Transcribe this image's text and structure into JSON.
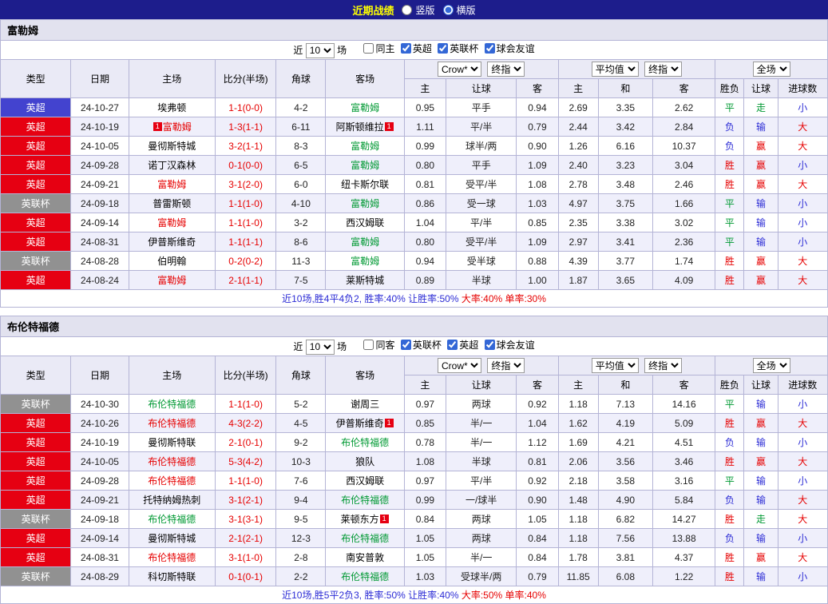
{
  "topbar": {
    "title": "近期战绩",
    "radios": [
      {
        "label": "竖版",
        "selected": false
      },
      {
        "label": "横版",
        "selected": true
      }
    ]
  },
  "filter_text": {
    "prefix": "近",
    "count": "10",
    "suffix": "场"
  },
  "table_header": {
    "main_cols": [
      "类型",
      "日期",
      "主场",
      "比分(半场)",
      "角球",
      "客场"
    ],
    "odds1": {
      "book": "Crow*",
      "stage": "终指",
      "cols": [
        "主",
        "让球",
        "客"
      ]
    },
    "odds2": {
      "book": "平均值",
      "stage": "终指",
      "cols": [
        "主",
        "和",
        "客"
      ]
    },
    "result": {
      "scope": "全场",
      "cols": [
        "胜负",
        "让球",
        "进球数"
      ]
    }
  },
  "team_colors": {
    "black": "#000000",
    "red": "#e60000",
    "green": "#009933"
  },
  "type_colors": {
    "red": "#e60012",
    "gray": "#919191",
    "blue": "#4343cf"
  },
  "result_colors": {
    "胜": "#e60000",
    "平": "#009933",
    "负": "#2b2bd5",
    "赢": "#e60000",
    "走": "#009933",
    "输": "#2b2bd5",
    "大": "#e60000",
    "小": "#2b2bd5"
  },
  "sections": [
    {
      "team": "富勒姆",
      "checkboxes": [
        {
          "label": "同主",
          "checked": false
        },
        {
          "label": "英超",
          "checked": true
        },
        {
          "label": "英联杯",
          "checked": true
        },
        {
          "label": "球会友谊",
          "checked": true
        }
      ],
      "rows": [
        {
          "type": "英超",
          "type_color": "blue",
          "date": "24-10-27",
          "home": {
            "name": "埃弗顿",
            "color": "black"
          },
          "score": "1-1(0-0)",
          "corner": "4-2",
          "away": {
            "name": "富勒姆",
            "color": "green"
          },
          "odds": [
            "0.95",
            "平手",
            "0.94",
            "2.69",
            "3.35",
            "2.62"
          ],
          "results": [
            "平",
            "走",
            "小"
          ]
        },
        {
          "type": "英超",
          "type_color": "red",
          "date": "24-10-19",
          "home": {
            "name": "富勒姆",
            "color": "red",
            "badge": "1",
            "badge_pos": "before"
          },
          "score": "1-3(1-1)",
          "corner": "6-11",
          "away": {
            "name": "阿斯顿维拉",
            "color": "black",
            "badge": "1",
            "badge_pos": "after"
          },
          "odds": [
            "1.11",
            "平/半",
            "0.79",
            "2.44",
            "3.42",
            "2.84"
          ],
          "results": [
            "负",
            "输",
            "大"
          ]
        },
        {
          "type": "英超",
          "type_color": "red",
          "date": "24-10-05",
          "home": {
            "name": "曼彻斯特城",
            "color": "black"
          },
          "score": "3-2(1-1)",
          "corner": "8-3",
          "away": {
            "name": "富勒姆",
            "color": "green"
          },
          "odds": [
            "0.99",
            "球半/两",
            "0.90",
            "1.26",
            "6.16",
            "10.37"
          ],
          "results": [
            "负",
            "赢",
            "大"
          ]
        },
        {
          "type": "英超",
          "type_color": "red",
          "date": "24-09-28",
          "home": {
            "name": "诺丁汉森林",
            "color": "black"
          },
          "score": "0-1(0-0)",
          "corner": "6-5",
          "away": {
            "name": "富勒姆",
            "color": "green"
          },
          "odds": [
            "0.80",
            "平手",
            "1.09",
            "2.40",
            "3.23",
            "3.04"
          ],
          "results": [
            "胜",
            "赢",
            "小"
          ]
        },
        {
          "type": "英超",
          "type_color": "red",
          "date": "24-09-21",
          "home": {
            "name": "富勒姆",
            "color": "red"
          },
          "score": "3-1(2-0)",
          "corner": "6-0",
          "away": {
            "name": "纽卡斯尔联",
            "color": "black"
          },
          "odds": [
            "0.81",
            "受平/半",
            "1.08",
            "2.78",
            "3.48",
            "2.46"
          ],
          "results": [
            "胜",
            "赢",
            "大"
          ]
        },
        {
          "type": "英联杯",
          "type_color": "gray",
          "date": "24-09-18",
          "home": {
            "name": "普雷斯顿",
            "color": "black"
          },
          "score": "1-1(1-0)",
          "corner": "4-10",
          "away": {
            "name": "富勒姆",
            "color": "green"
          },
          "odds": [
            "0.86",
            "受一球",
            "1.03",
            "4.97",
            "3.75",
            "1.66"
          ],
          "results": [
            "平",
            "输",
            "小"
          ]
        },
        {
          "type": "英超",
          "type_color": "red",
          "date": "24-09-14",
          "home": {
            "name": "富勒姆",
            "color": "red"
          },
          "score": "1-1(1-0)",
          "corner": "3-2",
          "away": {
            "name": "西汉姆联",
            "color": "black"
          },
          "odds": [
            "1.04",
            "平/半",
            "0.85",
            "2.35",
            "3.38",
            "3.02"
          ],
          "results": [
            "平",
            "输",
            "小"
          ]
        },
        {
          "type": "英超",
          "type_color": "red",
          "date": "24-08-31",
          "home": {
            "name": "伊普斯维奇",
            "color": "black"
          },
          "score": "1-1(1-1)",
          "corner": "8-6",
          "away": {
            "name": "富勒姆",
            "color": "green"
          },
          "odds": [
            "0.80",
            "受平/半",
            "1.09",
            "2.97",
            "3.41",
            "2.36"
          ],
          "results": [
            "平",
            "输",
            "小"
          ]
        },
        {
          "type": "英联杯",
          "type_color": "gray",
          "date": "24-08-28",
          "home": {
            "name": "伯明翰",
            "color": "black"
          },
          "score": "0-2(0-2)",
          "corner": "11-3",
          "away": {
            "name": "富勒姆",
            "color": "green"
          },
          "odds": [
            "0.94",
            "受半球",
            "0.88",
            "4.39",
            "3.77",
            "1.74"
          ],
          "results": [
            "胜",
            "赢",
            "大"
          ]
        },
        {
          "type": "英超",
          "type_color": "red",
          "date": "24-08-24",
          "home": {
            "name": "富勒姆",
            "color": "red"
          },
          "score": "2-1(1-1)",
          "corner": "7-5",
          "away": {
            "name": "莱斯特城",
            "color": "black"
          },
          "odds": [
            "0.89",
            "半球",
            "1.00",
            "1.87",
            "3.65",
            "4.09"
          ],
          "results": [
            "胜",
            "赢",
            "大"
          ]
        }
      ],
      "summary": [
        {
          "text": "近10场,胜4平4负2, ",
          "color": "#2b2bd5"
        },
        {
          "text": "胜率:40% ",
          "color": "#2b2bd5"
        },
        {
          "text": "让胜率:50% ",
          "color": "#2b2bd5"
        },
        {
          "text": "大率:40% ",
          "color": "#e60000"
        },
        {
          "text": "单率:30%",
          "color": "#e60000"
        }
      ]
    },
    {
      "team": "布伦特福德",
      "checkboxes": [
        {
          "label": "同客",
          "checked": false
        },
        {
          "label": "英联杯",
          "checked": true
        },
        {
          "label": "英超",
          "checked": true
        },
        {
          "label": "球会友谊",
          "checked": true
        }
      ],
      "rows": [
        {
          "type": "英联杯",
          "type_color": "gray",
          "date": "24-10-30",
          "home": {
            "name": "布伦特福德",
            "color": "green"
          },
          "score": "1-1(1-0)",
          "corner": "5-2",
          "away": {
            "name": "谢周三",
            "color": "black"
          },
          "odds": [
            "0.97",
            "两球",
            "0.92",
            "1.18",
            "7.13",
            "14.16"
          ],
          "results": [
            "平",
            "输",
            "小"
          ]
        },
        {
          "type": "英超",
          "type_color": "red",
          "date": "24-10-26",
          "home": {
            "name": "布伦特福德",
            "color": "red"
          },
          "score": "4-3(2-2)",
          "corner": "4-5",
          "away": {
            "name": "伊普斯维奇",
            "color": "black",
            "badge": "1",
            "badge_pos": "after"
          },
          "odds": [
            "0.85",
            "半/一",
            "1.04",
            "1.62",
            "4.19",
            "5.09"
          ],
          "results": [
            "胜",
            "赢",
            "大"
          ]
        },
        {
          "type": "英超",
          "type_color": "red",
          "date": "24-10-19",
          "home": {
            "name": "曼彻斯特联",
            "color": "black"
          },
          "score": "2-1(0-1)",
          "corner": "9-2",
          "away": {
            "name": "布伦特福德",
            "color": "green"
          },
          "odds": [
            "0.78",
            "半/一",
            "1.12",
            "1.69",
            "4.21",
            "4.51"
          ],
          "results": [
            "负",
            "输",
            "小"
          ]
        },
        {
          "type": "英超",
          "type_color": "red",
          "date": "24-10-05",
          "home": {
            "name": "布伦特福德",
            "color": "red"
          },
          "score": "5-3(4-2)",
          "corner": "10-3",
          "away": {
            "name": "狼队",
            "color": "black"
          },
          "odds": [
            "1.08",
            "半球",
            "0.81",
            "2.06",
            "3.56",
            "3.46"
          ],
          "results": [
            "胜",
            "赢",
            "大"
          ]
        },
        {
          "type": "英超",
          "type_color": "red",
          "date": "24-09-28",
          "home": {
            "name": "布伦特福德",
            "color": "red"
          },
          "score": "1-1(1-0)",
          "corner": "7-6",
          "away": {
            "name": "西汉姆联",
            "color": "black"
          },
          "odds": [
            "0.97",
            "平/半",
            "0.92",
            "2.18",
            "3.58",
            "3.16"
          ],
          "results": [
            "平",
            "输",
            "小"
          ]
        },
        {
          "type": "英超",
          "type_color": "red",
          "date": "24-09-21",
          "home": {
            "name": "托特纳姆热刺",
            "color": "black"
          },
          "score": "3-1(2-1)",
          "corner": "9-4",
          "away": {
            "name": "布伦特福德",
            "color": "green"
          },
          "odds": [
            "0.99",
            "一/球半",
            "0.90",
            "1.48",
            "4.90",
            "5.84"
          ],
          "results": [
            "负",
            "输",
            "大"
          ]
        },
        {
          "type": "英联杯",
          "type_color": "gray",
          "date": "24-09-18",
          "home": {
            "name": "布伦特福德",
            "color": "green"
          },
          "score": "3-1(3-1)",
          "corner": "9-5",
          "away": {
            "name": "莱顿东方",
            "color": "black",
            "badge": "1",
            "badge_pos": "after"
          },
          "odds": [
            "0.84",
            "两球",
            "1.05",
            "1.18",
            "6.82",
            "14.27"
          ],
          "results": [
            "胜",
            "走",
            "大"
          ]
        },
        {
          "type": "英超",
          "type_color": "red",
          "date": "24-09-14",
          "home": {
            "name": "曼彻斯特城",
            "color": "black"
          },
          "score": "2-1(2-1)",
          "corner": "12-3",
          "away": {
            "name": "布伦特福德",
            "color": "green"
          },
          "odds": [
            "1.05",
            "两球",
            "0.84",
            "1.18",
            "7.56",
            "13.88"
          ],
          "results": [
            "负",
            "输",
            "小"
          ]
        },
        {
          "type": "英超",
          "type_color": "red",
          "date": "24-08-31",
          "home": {
            "name": "布伦特福德",
            "color": "red"
          },
          "score": "3-1(1-0)",
          "corner": "2-8",
          "away": {
            "name": "南安普敦",
            "color": "black"
          },
          "odds": [
            "1.05",
            "半/一",
            "0.84",
            "1.78",
            "3.81",
            "4.37"
          ],
          "results": [
            "胜",
            "赢",
            "大"
          ]
        },
        {
          "type": "英联杯",
          "type_color": "gray",
          "date": "24-08-29",
          "home": {
            "name": "科切斯特联",
            "color": "black"
          },
          "score": "0-1(0-1)",
          "corner": "2-2",
          "away": {
            "name": "布伦特福德",
            "color": "green"
          },
          "odds": [
            "1.03",
            "受球半/两",
            "0.79",
            "11.85",
            "6.08",
            "1.22"
          ],
          "results": [
            "胜",
            "输",
            "小"
          ]
        }
      ],
      "summary": [
        {
          "text": "近10场,胜5平2负3, ",
          "color": "#2b2bd5"
        },
        {
          "text": "胜率:50% ",
          "color": "#2b2bd5"
        },
        {
          "text": "让胜率:40% ",
          "color": "#2b2bd5"
        },
        {
          "text": "大率:50% ",
          "color": "#e60000"
        },
        {
          "text": "单率:40%",
          "color": "#e60000"
        }
      ]
    }
  ]
}
